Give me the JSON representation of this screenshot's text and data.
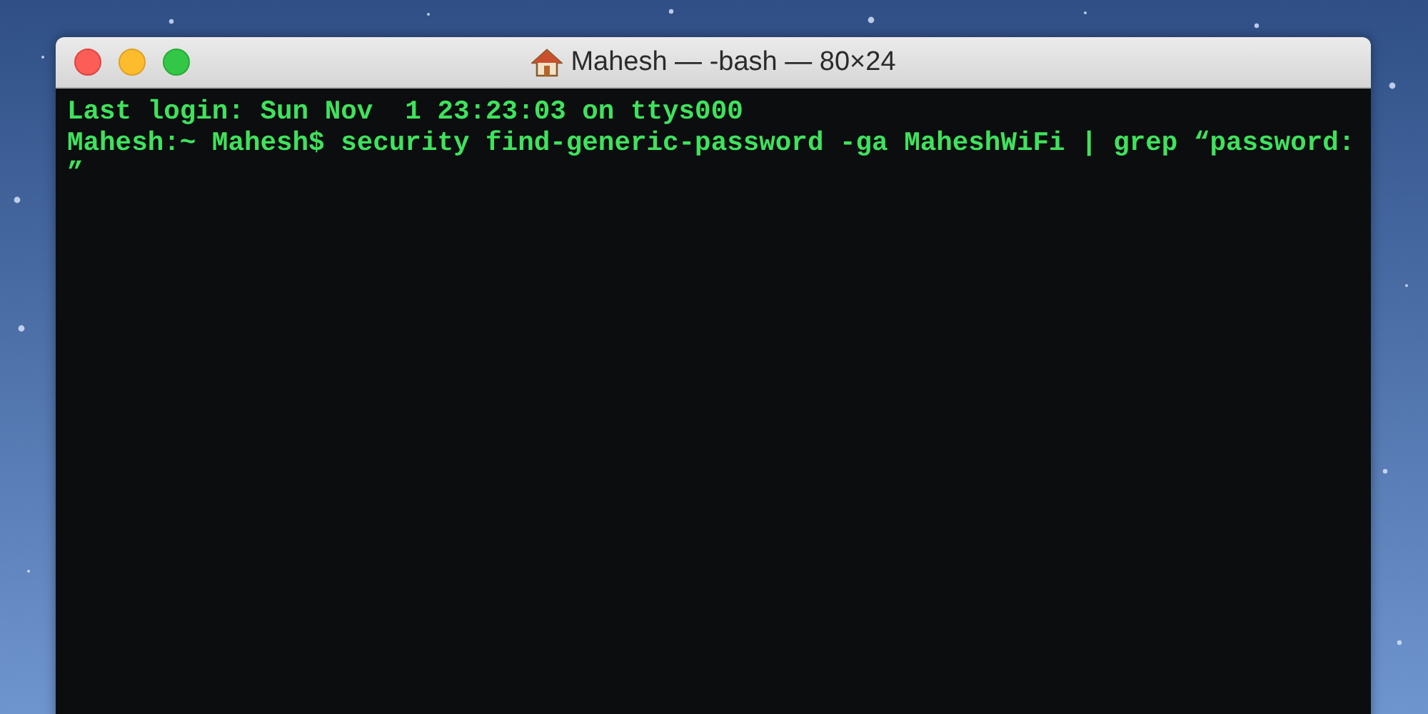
{
  "window": {
    "title": "Mahesh — -bash — 80×24",
    "terminal_lines": [
      "Last login: Sun Nov  1 23:23:03 on ttys000",
      "Mahesh:~ Mahesh$ security find-generic-password -ga MaheshWiFi | grep “password:",
      "”"
    ]
  }
}
